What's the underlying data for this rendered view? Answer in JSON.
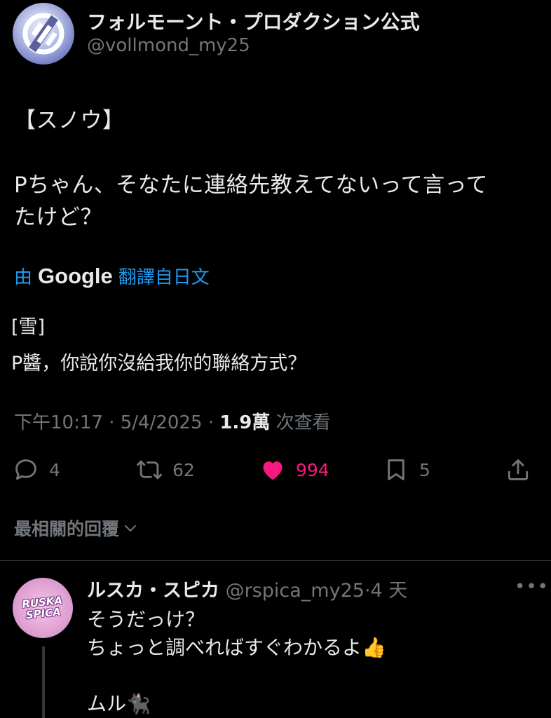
{
  "post": {
    "author_name": "フォルモーント・プロダクション公式",
    "author_handle": "@vollmond_my25",
    "text_lines": [
      "【スノウ】",
      "Pちゃん、そなたに連絡先教えてないって言って",
      "たけど？"
    ],
    "translate": {
      "prefix": "由",
      "brand": "Google",
      "suffix": "翻譯自日文"
    },
    "translation_lines": [
      "[雪]",
      "P醬，你說你沒給我你的聯絡方式？"
    ],
    "meta": {
      "time": "下午10:17",
      "date": "5/4/2025",
      "views": "1.9萬",
      "views_label": "次查看",
      "sep": "·"
    },
    "actions": {
      "replies": "4",
      "reposts": "62",
      "likes": "994",
      "bookmarks": "5"
    }
  },
  "replies_sort": {
    "label": "最相關的回覆"
  },
  "reply": {
    "author_name": "ルスカ・スピカ",
    "author_handle": "@rspica_my25",
    "age": "4 天",
    "sep": "·",
    "avatar_text": "RUSKA SPICA",
    "text_lines": [
      "そうだっけ？",
      "ちょっと調べればすぐわかるよ👍",
      "",
      "ムル🐈‍⬛"
    ]
  },
  "colors": {
    "accent_link": "#1d9bf0",
    "like": "#f91880",
    "muted": "#71767b",
    "text": "#e7e9ea",
    "background": "#000000"
  }
}
